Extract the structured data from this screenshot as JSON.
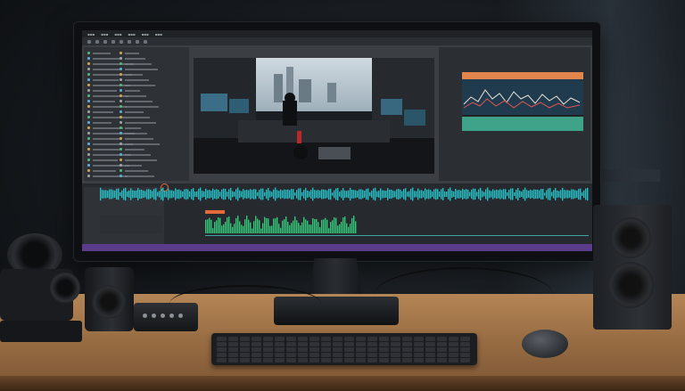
{
  "scene": {
    "description_colors": {
      "wall": "#15191d",
      "desk": "#9a6e44",
      "waveform": "#27c2c9",
      "accent_orange": "#e46a3a",
      "status_purple": "#5a3c8a"
    }
  },
  "editor": {
    "menu_items": [
      "",
      "",
      "",
      "",
      "",
      "",
      ""
    ],
    "panels": [
      "project-panel",
      "program-viewer",
      "scope-panel",
      "timeline"
    ]
  }
}
